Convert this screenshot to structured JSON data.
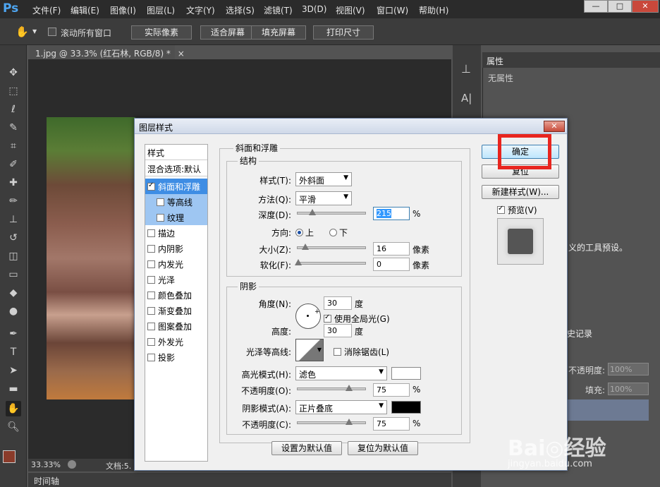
{
  "app": {
    "logo": "Ps"
  },
  "menu": [
    "文件(F)",
    "编辑(E)",
    "图像(I)",
    "图层(L)",
    "文字(Y)",
    "选择(S)",
    "滤镜(T)",
    "3D(D)",
    "视图(V)",
    "窗口(W)",
    "帮助(H)"
  ],
  "window_controls": {
    "minimize": "—",
    "restore": "□",
    "close": "✕"
  },
  "options": {
    "scroll_all_label": "滚动所有窗口",
    "actual_pixels": "实际像素",
    "fit_screen": "适合屏幕",
    "fill_screen": "填充屏幕",
    "print_size": "打印尺寸"
  },
  "document": {
    "tab_title": "1.jpg @ 33.3% (红石林, RGB/8) *",
    "tab_close": "×",
    "zoom": "33.33%",
    "status": "文档:5.",
    "timeline": "时间轴"
  },
  "right_panels": {
    "properties_tab": "属性",
    "no_properties": "无属性",
    "preset_text": "义的工具预设。",
    "history_tab": "史记录",
    "opacity_label": "不透明度:",
    "opacity_value": "100%",
    "fill_label": "填充:",
    "fill_value": "100%"
  },
  "dialog": {
    "title": "图层样式",
    "close": "✕",
    "styles_header": "样式",
    "blending_options": "混合选项:默认",
    "styles": [
      {
        "label": "斜面和浮雕",
        "checked": true,
        "selected": true
      },
      {
        "label": "等高线",
        "checked": false,
        "sub": true
      },
      {
        "label": "纹理",
        "checked": false,
        "sub": true
      },
      {
        "label": "描边",
        "checked": false
      },
      {
        "label": "内阴影",
        "checked": false
      },
      {
        "label": "内发光",
        "checked": false
      },
      {
        "label": "光泽",
        "checked": false
      },
      {
        "label": "颜色叠加",
        "checked": false
      },
      {
        "label": "渐变叠加",
        "checked": false
      },
      {
        "label": "图案叠加",
        "checked": false
      },
      {
        "label": "外发光",
        "checked": false
      },
      {
        "label": "投影",
        "checked": false
      }
    ],
    "bevel": {
      "group_title": "斜面和浮雕",
      "structure_title": "结构",
      "style_label": "样式(T):",
      "style_value": "外斜面",
      "technique_label": "方法(Q):",
      "technique_value": "平滑",
      "depth_label": "深度(D):",
      "depth_value": "215",
      "depth_unit": "%",
      "direction_label": "方向:",
      "direction_up": "上",
      "direction_down": "下",
      "size_label": "大小(Z):",
      "size_value": "16",
      "size_unit": "像素",
      "soften_label": "软化(F):",
      "soften_value": "0",
      "soften_unit": "像素"
    },
    "shading": {
      "title": "阴影",
      "angle_label": "角度(N):",
      "angle_value": "30",
      "angle_unit": "度",
      "global_light": "使用全局光(G)",
      "altitude_label": "高度:",
      "altitude_value": "30",
      "altitude_unit": "度",
      "gloss_contour_label": "光泽等高线:",
      "anti_aliased": "消除锯齿(L)",
      "highlight_mode_label": "高光模式(H):",
      "highlight_mode_value": "滤色",
      "highlight_color": "#ffffff",
      "highlight_opacity_label": "不透明度(O):",
      "highlight_opacity_value": "75",
      "highlight_opacity_unit": "%",
      "shadow_mode_label": "阴影模式(A):",
      "shadow_mode_value": "正片叠底",
      "shadow_color": "#000000",
      "shadow_opacity_label": "不透明度(C):",
      "shadow_opacity_value": "75",
      "shadow_opacity_unit": "%"
    },
    "make_default": "设置为默认值",
    "reset_default": "复位为默认值",
    "ok": "确定",
    "reset": "复位",
    "new_style": "新建样式(W)...",
    "preview_label": "预览(V)"
  },
  "watermark": {
    "brand": "Bai◎经验",
    "url": "jingyan.baidu.com"
  }
}
